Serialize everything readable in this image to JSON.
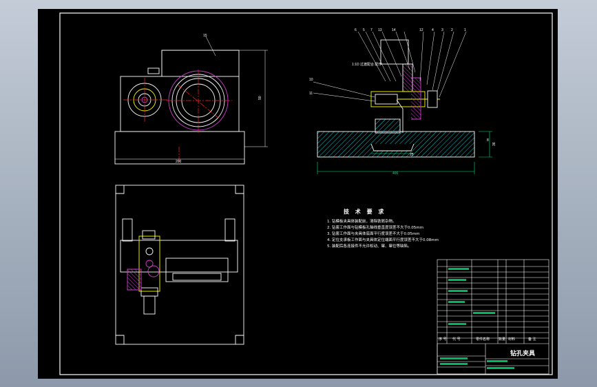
{
  "title_block": {
    "drawing_name": "钻孔夹具",
    "header_row": [
      "序 号",
      "代   号",
      "零件名称",
      "数量",
      "材料",
      "备 注"
    ]
  },
  "technical_requirements": {
    "heading": "技 术 要 求",
    "items": [
      "1. 钻模板夹具体装配前，清除铁屑杂物。",
      "2. 钻套工作面与钻模板孔轴线垂直度误差不大于0.05mm",
      "3. 钻套工作面与夹具体底面平行度误差不大于0.05mm",
      "4. 定位支承板工作面与夹具体定位端面平行度误差不大于0.08mm",
      "5. 装配后各连接件不允许松动、窜、窜位等缺陷。"
    ]
  },
  "dimension_labels": {
    "top_view_width": "200",
    "top_view_height": "90",
    "section_width": "400",
    "section_height": "36",
    "section_slot": "25",
    "section_small": "8",
    "fit_note": "1:1D 过渡配合\n配作",
    "part_15": "15"
  },
  "balloons": [
    "6",
    "5",
    "7",
    "13",
    "14",
    "12",
    "4",
    "3",
    "2",
    "1",
    "10",
    "11"
  ],
  "colors": {
    "background": "#000000",
    "line": "#ffffff",
    "section_hatch": "#00c8d2",
    "dimension": "#00e676",
    "center_line": "#ff2424",
    "part_highlight": "#d23cd2",
    "yellow": "#ffff00"
  }
}
